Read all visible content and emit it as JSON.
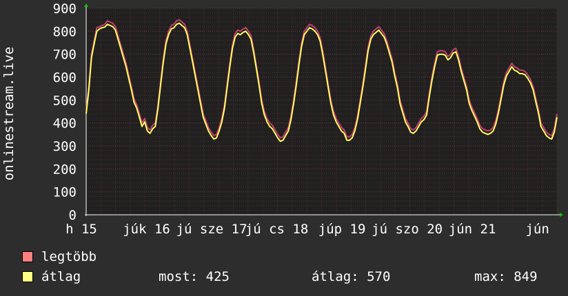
{
  "chart_data": {
    "type": "line",
    "ylabel": "onlinestream.live",
    "ylim": [
      0,
      900
    ],
    "y_ticks": [
      0,
      100,
      200,
      300,
      400,
      500,
      600,
      700,
      800,
      900
    ],
    "x_ticks": [
      "h 15",
      "júk 16",
      "jú sze 17",
      "jú cs 18",
      "júp 19",
      "jú szo 20",
      "jún 21",
      "jún"
    ],
    "grid": true,
    "series": [
      {
        "name": "legtöbb",
        "color": "#ff7f7f",
        "values": [
          455,
          560,
          700,
          760,
          815,
          820,
          825,
          830,
          845,
          840,
          835,
          820,
          780,
          740,
          700,
          660,
          610,
          560,
          505,
          480,
          440,
          400,
          420,
          380,
          370,
          390,
          400,
          480,
          580,
          680,
          760,
          800,
          825,
          830,
          845,
          850,
          840,
          830,
          800,
          740,
          680,
          620,
          560,
          500,
          440,
          410,
          380,
          360,
          345,
          350,
          380,
          420,
          480,
          570,
          660,
          740,
          790,
          805,
          800,
          810,
          815,
          800,
          780,
          720,
          650,
          580,
          500,
          450,
          420,
          400,
          390,
          370,
          350,
          335,
          340,
          360,
          380,
          430,
          500,
          580,
          670,
          750,
          800,
          815,
          830,
          825,
          815,
          800,
          770,
          710,
          640,
          570,
          500,
          450,
          420,
          400,
          380,
          370,
          340,
          340,
          350,
          380,
          430,
          500,
          570,
          650,
          730,
          780,
          800,
          810,
          820,
          805,
          790,
          760,
          720,
          680,
          620,
          570,
          500,
          460,
          420,
          400,
          375,
          370,
          380,
          400,
          420,
          430,
          450,
          530,
          600,
          660,
          710,
          715,
          715,
          710,
          690,
          700,
          720,
          725,
          690,
          640,
          600,
          560,
          500,
          470,
          445,
          420,
          390,
          375,
          370,
          365,
          370,
          380,
          410,
          460,
          520,
          580,
          620,
          640,
          660,
          645,
          640,
          630,
          630,
          625,
          610,
          590,
          560,
          510,
          460,
          400,
          380,
          360,
          350,
          345,
          375,
          440
        ],
        "line_color": "#c44070"
      },
      {
        "name": "átlag",
        "color": "#ffff80",
        "values": [
          440,
          545,
          685,
          745,
          800,
          810,
          815,
          818,
          830,
          825,
          820,
          805,
          765,
          725,
          685,
          645,
          595,
          545,
          490,
          465,
          425,
          385,
          405,
          365,
          355,
          375,
          385,
          465,
          565,
          665,
          745,
          785,
          810,
          815,
          830,
          835,
          825,
          815,
          785,
          725,
          665,
          605,
          545,
          485,
          425,
          395,
          365,
          345,
          330,
          335,
          365,
          405,
          465,
          555,
          645,
          725,
          775,
          790,
          785,
          795,
          800,
          785,
          765,
          705,
          635,
          565,
          485,
          435,
          405,
          385,
          375,
          355,
          335,
          320,
          325,
          345,
          365,
          415,
          485,
          565,
          655,
          735,
          785,
          800,
          815,
          810,
          800,
          785,
          755,
          695,
          625,
          555,
          485,
          435,
          405,
          385,
          365,
          355,
          325,
          325,
          335,
          365,
          415,
          485,
          555,
          635,
          715,
          765,
          785,
          795,
          805,
          790,
          775,
          745,
          705,
          665,
          605,
          555,
          485,
          445,
          405,
          385,
          360,
          355,
          365,
          385,
          405,
          415,
          435,
          515,
          585,
          645,
          695,
          700,
          700,
          695,
          675,
          685,
          705,
          710,
          675,
          625,
          585,
          545,
          485,
          455,
          430,
          405,
          375,
          360,
          355,
          350,
          355,
          365,
          395,
          445,
          505,
          565,
          605,
          625,
          645,
          630,
          625,
          615,
          615,
          610,
          595,
          575,
          545,
          495,
          445,
          385,
          365,
          345,
          335,
          330,
          360,
          425
        ],
        "line_color": "#ffff60"
      }
    ],
    "stats": {
      "most_label": "most:",
      "most_value": "425",
      "atlag_label": "átlag:",
      "atlag_value": "570",
      "max_label": "max:",
      "max_value": "849"
    }
  }
}
